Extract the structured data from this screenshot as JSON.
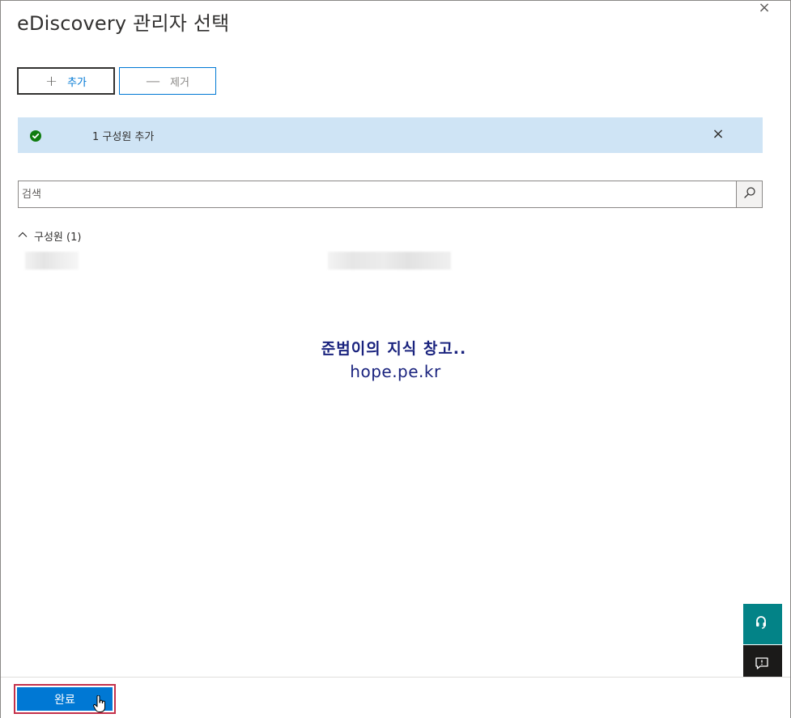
{
  "panel": {
    "title": "eDiscovery 관리자 선택",
    "close_glyph": "×"
  },
  "toolbar": {
    "add_icon": "plus-icon",
    "add_label": "추가",
    "remove_icon": "minus-icon",
    "remove_label": "제거"
  },
  "notification": {
    "icon": "success-check-icon",
    "message": "1 구성원 추가",
    "dismiss_glyph": "×",
    "background": "#cfe4f5",
    "icon_color": "#107c10"
  },
  "search": {
    "placeholder": "검색",
    "value": "",
    "icon": "search-icon"
  },
  "members": {
    "group_label": "구성원 (1)",
    "expanded": true
  },
  "watermark": {
    "line1": "준범이의 지식 창고..",
    "line2": "hope.pe.kr"
  },
  "side_buttons": {
    "help_icon": "headset-icon",
    "feedback_icon": "feedback-icon"
  },
  "footer": {
    "done_label": "완료",
    "accent": "#0078d4"
  }
}
